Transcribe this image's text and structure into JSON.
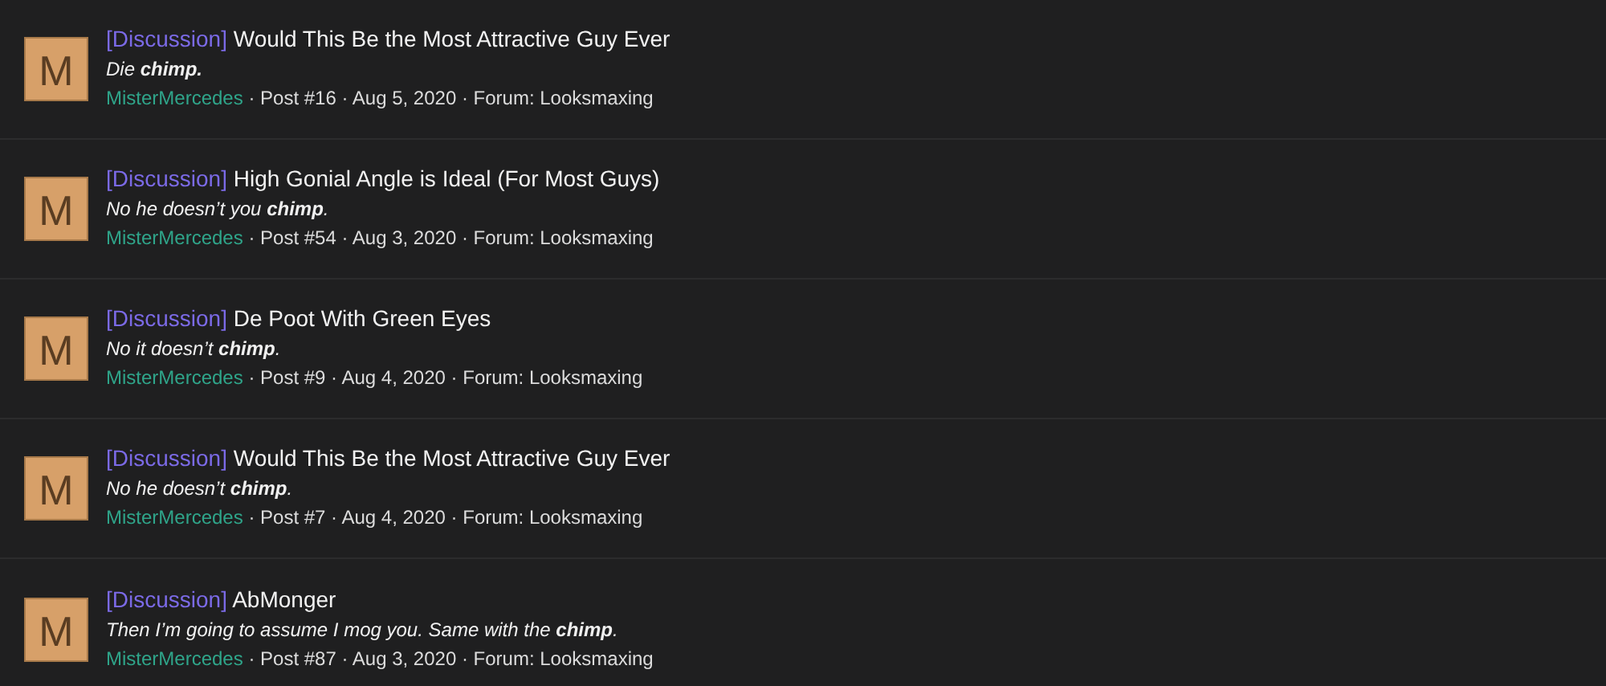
{
  "results": [
    {
      "avatar": "M",
      "prefix": "[Discussion]",
      "title": "Would This Be the Most Attractive Guy Ever",
      "snippet": "Die **chimp.**",
      "author": "MisterMercedes",
      "meta": "· Post #16 · Aug 5, 2020 · Forum: Looksmaxing"
    },
    {
      "avatar": "M",
      "prefix": "[Discussion]",
      "title": "High Gonial Angle is Ideal (For Most Guys)",
      "snippet": "No he doesn’t you **chimp**.",
      "author": "MisterMercedes",
      "meta": "· Post #54 · Aug 3, 2020 · Forum: Looksmaxing"
    },
    {
      "avatar": "M",
      "prefix": "[Discussion]",
      "title": "De Poot With Green Eyes",
      "snippet": "No it doesn’t **chimp**.",
      "author": "MisterMercedes",
      "meta": "· Post #9 · Aug 4, 2020 · Forum: Looksmaxing"
    },
    {
      "avatar": "M",
      "prefix": "[Discussion]",
      "title": "Would This Be the Most Attractive Guy Ever",
      "snippet": "No he doesn’t **chimp**.",
      "author": "MisterMercedes",
      "meta": "· Post #7 · Aug 4, 2020 · Forum: Looksmaxing"
    },
    {
      "avatar": "M",
      "prefix": "[Discussion]",
      "title": "AbMonger",
      "snippet": "Then I’m going to assume I mog you. Same with the **chimp**.",
      "author": "MisterMercedes",
      "meta": "· Post #87 · Aug 3, 2020 · Forum: Looksmaxing"
    }
  ]
}
